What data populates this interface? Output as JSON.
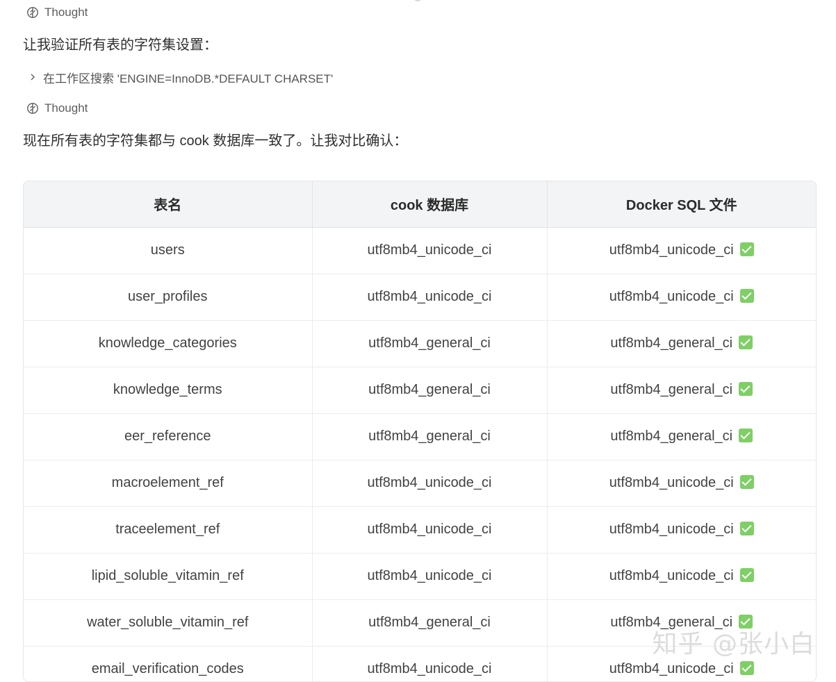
{
  "thought_label": "Thought",
  "thought_label_2": "Thought",
  "message_1": "让我验证所有表的字符集设置：",
  "search_action": "在工作区搜索 'ENGINE=InnoDB.*DEFAULT CHARSET'",
  "message_2": "现在所有表的字符集都与 cook 数据库一致了。让我对比确认：",
  "table": {
    "headers": [
      "表名",
      "cook 数据库",
      "Docker SQL 文件"
    ],
    "rows": [
      [
        "users",
        "utf8mb4_unicode_ci",
        "utf8mb4_unicode_ci"
      ],
      [
        "user_profiles",
        "utf8mb4_unicode_ci",
        "utf8mb4_unicode_ci"
      ],
      [
        "knowledge_categories",
        "utf8mb4_general_ci",
        "utf8mb4_general_ci"
      ],
      [
        "knowledge_terms",
        "utf8mb4_general_ci",
        "utf8mb4_general_ci"
      ],
      [
        "eer_reference",
        "utf8mb4_general_ci",
        "utf8mb4_general_ci"
      ],
      [
        "macroelement_ref",
        "utf8mb4_unicode_ci",
        "utf8mb4_unicode_ci"
      ],
      [
        "traceelement_ref",
        "utf8mb4_unicode_ci",
        "utf8mb4_unicode_ci"
      ],
      [
        "lipid_soluble_vitamin_ref",
        "utf8mb4_unicode_ci",
        "utf8mb4_unicode_ci"
      ],
      [
        "water_soluble_vitamin_ref",
        "utf8mb4_general_ci",
        "utf8mb4_general_ci"
      ],
      [
        "email_verification_codes",
        "utf8mb4_unicode_ci",
        "utf8mb4_unicode_ci"
      ]
    ]
  },
  "icons": {
    "thought": "brain-icon",
    "search_toggle": "chevron-right-icon",
    "match": "green-check-icon"
  },
  "colors": {
    "check": "#7fcf67",
    "header_bg": "#f3f4f6"
  },
  "watermark": "知乎 @张小白"
}
